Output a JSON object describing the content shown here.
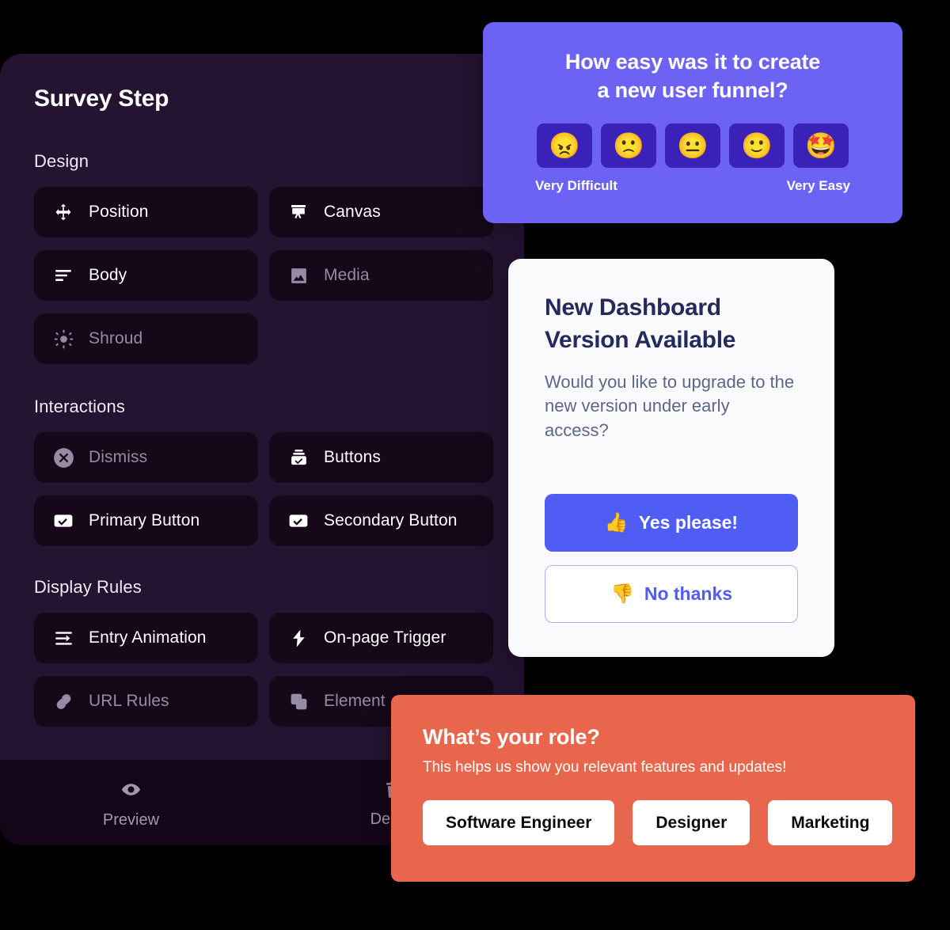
{
  "editor": {
    "title": "Survey Step",
    "sections": [
      {
        "label": "Design",
        "items": [
          {
            "label": "Position",
            "icon": "move-arrows-icon",
            "dim": false
          },
          {
            "label": "Canvas",
            "icon": "easel-icon",
            "dim": false
          },
          {
            "label": "Body",
            "icon": "text-lines-icon",
            "dim": false
          },
          {
            "label": "Media",
            "icon": "image-icon",
            "dim": true
          },
          {
            "label": "Shroud",
            "icon": "sun-icon",
            "dim": true
          }
        ]
      },
      {
        "label": "Interactions",
        "items": [
          {
            "label": "Dismiss",
            "icon": "circle-x-icon",
            "dim": true
          },
          {
            "label": "Buttons",
            "icon": "button-stack-icon",
            "dim": false
          },
          {
            "label": "Primary Button",
            "icon": "check-box-icon",
            "dim": false
          },
          {
            "label": "Secondary Button",
            "icon": "check-box-icon",
            "dim": false
          }
        ]
      },
      {
        "label": "Display Rules",
        "items": [
          {
            "label": "Entry Animation",
            "icon": "arrow-in-icon",
            "dim": false
          },
          {
            "label": "On-page Trigger",
            "icon": "lightning-icon",
            "dim": false
          },
          {
            "label": "URL Rules",
            "icon": "link-chain-icon",
            "dim": true
          },
          {
            "label": "Element",
            "icon": "copy-icon",
            "dim": true
          }
        ]
      }
    ],
    "footer": [
      {
        "label": "Preview",
        "icon": "eye-icon"
      },
      {
        "label": "Delete",
        "icon": "trash-icon"
      }
    ]
  },
  "survey_card": {
    "question": "How easy was it to create\na new user funnel?",
    "question_line1": "How easy was it to create",
    "question_line2": "a new user funnel?",
    "options": [
      {
        "emoji": "😠",
        "name": "angry-face"
      },
      {
        "emoji": "🙁",
        "name": "slightly-frowning-face"
      },
      {
        "emoji": "😐",
        "name": "neutral-face"
      },
      {
        "emoji": "🙂",
        "name": "slightly-smiling-face"
      },
      {
        "emoji": "🤩",
        "name": "star-struck-face"
      }
    ],
    "legend_low": "Very Difficult",
    "legend_high": "Very Easy",
    "background_color": "#6C63F5",
    "tile_color": "#3A22B8"
  },
  "dashboard_card": {
    "title_line1": "New Dashboard",
    "title_line2": "Version Available",
    "body": "Would you like to upgrade to the new version under early access?",
    "primary_button": {
      "emoji": "👍",
      "label": "Yes please!"
    },
    "secondary_button": {
      "emoji": "👎",
      "label": "No thanks"
    },
    "accent_color": "#4F5DF5"
  },
  "role_card": {
    "title": "What’s your role?",
    "subtitle": "This helps us show you relevant features and updates!",
    "options": [
      "Software Engineer",
      "Designer",
      "Marketing"
    ],
    "background_color": "#E8674C"
  }
}
